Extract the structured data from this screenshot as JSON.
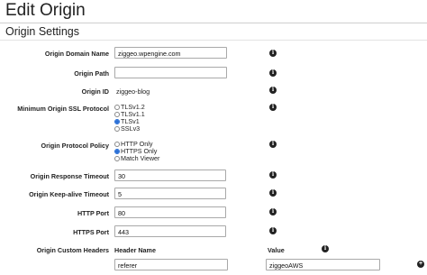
{
  "page": {
    "title": "Edit Origin",
    "section_title": "Origin Settings"
  },
  "fields": {
    "origin_domain_name": {
      "label": "Origin Domain Name",
      "value": "ziggeo.wpengine.com"
    },
    "origin_path": {
      "label": "Origin Path",
      "value": ""
    },
    "origin_id": {
      "label": "Origin ID",
      "value": "ziggeo-blog"
    },
    "min_ssl": {
      "label": "Minimum Origin SSL Protocol",
      "options": [
        "TLSv1.2",
        "TLSv1.1",
        "TLSv1",
        "SSLv3"
      ],
      "selected": "TLSv1"
    },
    "protocol_policy": {
      "label": "Origin Protocol Policy",
      "options": [
        "HTTP Only",
        "HTTPS Only",
        "Match Viewer"
      ],
      "selected": "HTTPS Only"
    },
    "response_timeout": {
      "label": "Origin Response Timeout",
      "value": "30"
    },
    "keepalive_timeout": {
      "label": "Origin Keep-alive Timeout",
      "value": "5"
    },
    "http_port": {
      "label": "HTTP Port",
      "value": "80"
    },
    "https_port": {
      "label": "HTTPS Port",
      "value": "443"
    },
    "custom_headers": {
      "label": "Origin Custom Headers",
      "header_name_col": "Header Name",
      "value_col": "Value",
      "rows": [
        {
          "name": "referer",
          "value": "ziggeoAWS"
        }
      ]
    }
  },
  "icons": {
    "info": "info-icon",
    "add": "plus-circle-icon"
  },
  "colors": {
    "radio_selected": "#2a6fd6",
    "input_border": "#a9a9a9"
  }
}
